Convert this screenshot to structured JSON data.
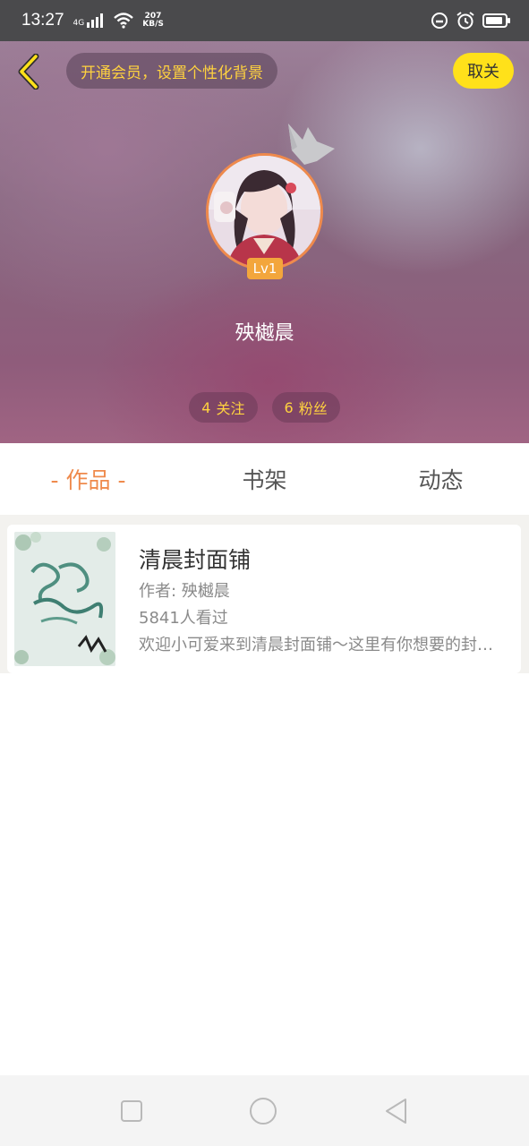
{
  "status_bar": {
    "time": "13:27",
    "network": "4G",
    "speed_value": "207",
    "speed_unit": "KB/S"
  },
  "header": {
    "vip_prompt": "开通会员，设置个性化背景",
    "follow_button": "取关",
    "level_badge": "Lv1",
    "username": "殃樾晨",
    "following_count": "4",
    "following_label": "关注",
    "followers_count": "6",
    "followers_label": "粉丝"
  },
  "tabs": [
    {
      "label": "- 作品 -",
      "active": true
    },
    {
      "label": "书架",
      "active": false
    },
    {
      "label": "动态",
      "active": false
    }
  ],
  "works": [
    {
      "title": "清晨封面铺",
      "author": "作者: 殃樾晨",
      "views": "5841人看过",
      "description": "欢迎小可爱来到清晨封面铺～这里有你想要的封面哦"
    }
  ],
  "colors": {
    "accent_orange": "#ef8a4c",
    "vip_yellow": "#ffd23f",
    "follow_button_bg": "#ffe11a",
    "level_badge_bg": "#f3a63c"
  },
  "icons": {
    "back": "chevron-left-icon",
    "crown": "crown-icon",
    "nav_recent": "square-icon",
    "nav_home": "circle-icon",
    "nav_back": "triangle-left-icon"
  }
}
